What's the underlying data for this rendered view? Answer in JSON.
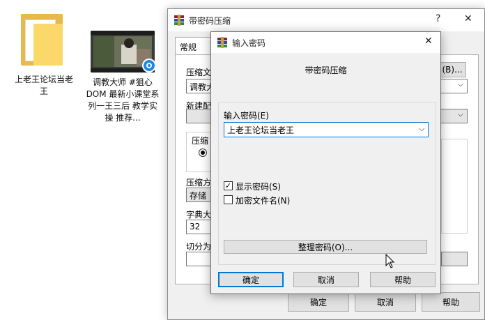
{
  "desktop": {
    "folder_label": "上老王论坛当老王",
    "video_label": "调教大师 #狙心 DOM 最新小课堂系列一王三后 教学实操 推荐..."
  },
  "bg_window": {
    "title": "带密码压缩",
    "help_glyph": "?",
    "minimize_glyph": "—",
    "close_glyph": "✕",
    "tab_general": "常规",
    "archive_label": "压缩文",
    "browse_label": "(B)...",
    "archive_value": "调教大",
    "new_profile_label": "新建配",
    "format_label": "压缩",
    "method_label": "压缩方",
    "method_value": "存储",
    "dict_label": "字典大",
    "dict_value": "32",
    "split_label": "切分为",
    "ok_label": "确定",
    "cancel_label": "取消",
    "help_label": "帮助"
  },
  "dialog": {
    "title": "输入密码",
    "close_glyph": "✕",
    "heading": "带密码压缩",
    "password_label": "输入密码(E)",
    "password_value": "上老王论坛当老王",
    "show_password_label": "显示密码(S)",
    "show_password_checked": true,
    "encrypt_names_label": "加密文件名(N)",
    "encrypt_names_checked": false,
    "organize_label": "整理密码(O)...",
    "ok_label": "确定",
    "cancel_label": "取消",
    "help_label": "帮助"
  },
  "colors": {
    "accent": "#0078d7",
    "folder": "#fbd86a",
    "badge": "#1e88e5"
  }
}
